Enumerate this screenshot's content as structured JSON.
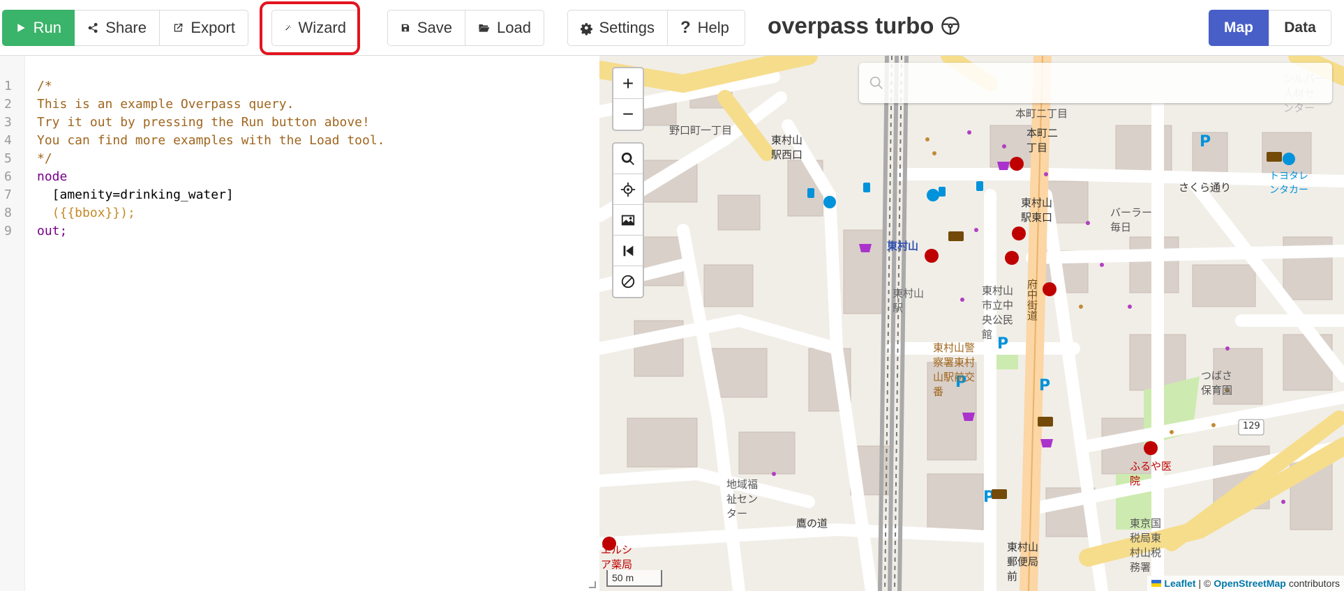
{
  "toolbar": {
    "run": "Run",
    "share": "Share",
    "export": "Export",
    "wizard": "Wizard",
    "save": "Save",
    "load": "Load",
    "settings": "Settings",
    "help": "Help"
  },
  "app_title": "overpass turbo",
  "view_toggle": {
    "map": "Map",
    "data": "Data"
  },
  "editor": {
    "lines": [
      {
        "n": "1",
        "text": "/*"
      },
      {
        "n": "2",
        "text": "This is an example Overpass query."
      },
      {
        "n": "3",
        "text": "Try it out by pressing the Run button above!"
      },
      {
        "n": "4",
        "text": "You can find more examples with the Load tool."
      },
      {
        "n": "5",
        "text": "*/"
      },
      {
        "n": "6",
        "text": "node"
      },
      {
        "n": "7",
        "text": "  [amenity=drinking_water]"
      },
      {
        "n": "8",
        "text": "  ({{bbox}});"
      },
      {
        "n": "9",
        "text": "out;"
      }
    ]
  },
  "map": {
    "zoom_in": "+",
    "zoom_out": "−",
    "scale": "50 m",
    "attribution": {
      "leaflet": "Leaflet",
      "sep": "| ©",
      "osm": "OpenStreetMap",
      "contributors": "contributors"
    },
    "labels": {
      "l1": "野口町一丁目",
      "l2": "東村山\n駅西口",
      "l3": "本町二丁目",
      "l4": "本町二\n丁目",
      "l5": "東村山\n駅東口",
      "l6": "さくら通り",
      "l7": "バーラー\n毎日",
      "l8": "東村山",
      "l9": "東村山\n市立中\n央公民\n館",
      "l10": "東村山警\n察署東村\n山駅前交\n番",
      "l11": "府中街道",
      "l12": "つばさ\n保育園",
      "l13": "129",
      "l14": "ふるや医\n院",
      "l15": "地域福\n祉セン\nター",
      "l16": "鷹の道",
      "l17": "東京国\n税局東\n村山税\n務署",
      "l18": "東村山\n郵便局\n前",
      "l19": "エルシ\nア薬局",
      "l20": "トヨタレ\nンタカー",
      "l21": "シルバー\n人材セ\nンター",
      "l22": "東村山\n駅"
    }
  }
}
